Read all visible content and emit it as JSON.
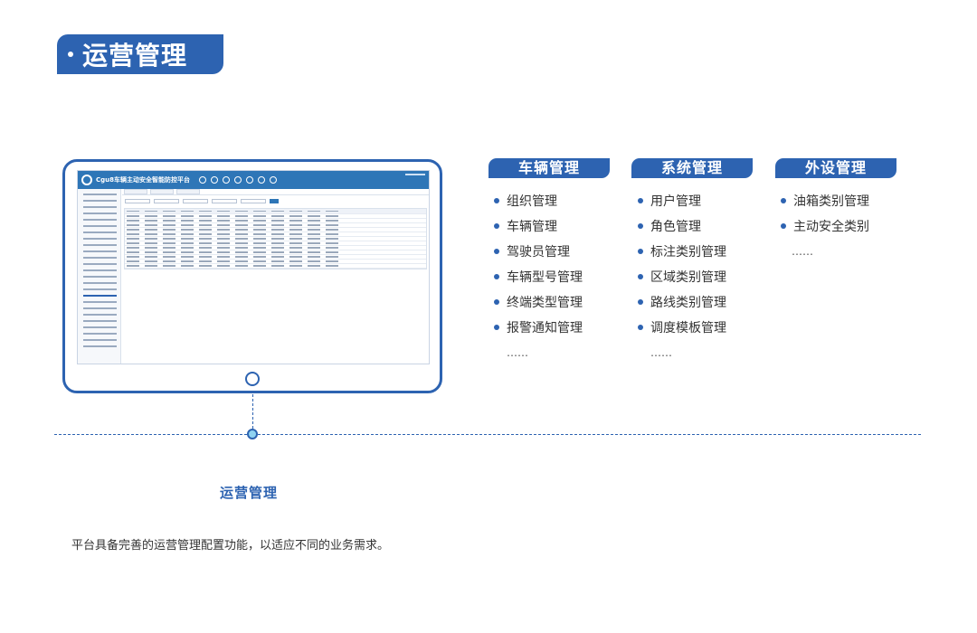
{
  "page_title": "运营管理",
  "screen_app": {
    "app_title": "Cgu8车辆主动安全智能防控平台"
  },
  "columns": [
    {
      "title": "车辆管理",
      "items": [
        "组织管理",
        "车辆管理",
        "驾驶员管理",
        "车辆型号管理",
        "终端类型管理",
        "报警通知管理"
      ],
      "more": "……"
    },
    {
      "title": "系统管理",
      "items": [
        "用户管理",
        "角色管理",
        "标注类别管理",
        "区域类别管理",
        "路线类别管理",
        "调度模板管理"
      ],
      "more": "……"
    },
    {
      "title": "外设管理",
      "items": [
        "油箱类别管理",
        "主动安全类别"
      ],
      "more": "……"
    }
  ],
  "section": {
    "title": "运营管理",
    "description": "平台具备完善的运营管理配置功能，以适应不同的业务需求。"
  },
  "colors": {
    "primary": "#2d63b1",
    "app_header": "#2e76b7",
    "node_fill": "#8fd3f2"
  }
}
